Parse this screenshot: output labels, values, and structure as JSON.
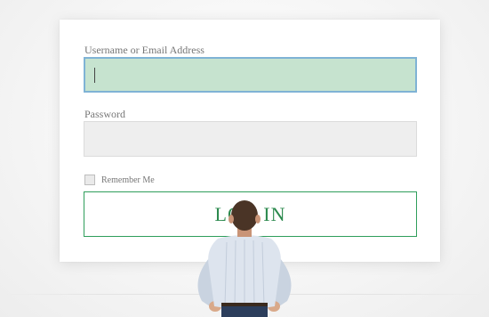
{
  "login_form": {
    "username_label": "Username or Email Address",
    "username_value": "",
    "password_label": "Password",
    "password_value": "",
    "remember_label": "Remember Me",
    "remember_checked": false,
    "login_button_label": "LOG IN"
  },
  "colors": {
    "accent_green": "#2c8a4e",
    "focus_fill": "#c6e3cf",
    "focus_border": "#7fb3d5"
  },
  "illustration": {
    "subject": "man-from-behind-hands-on-hips"
  }
}
